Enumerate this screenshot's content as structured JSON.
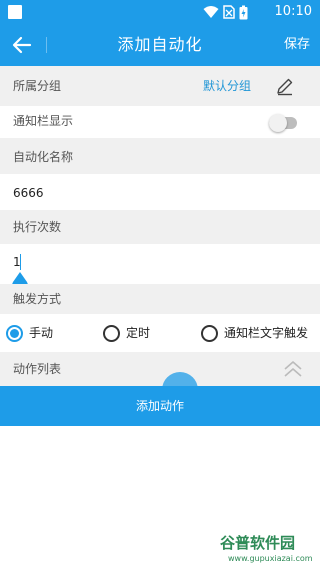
{
  "status_bar": {
    "time": "10:10",
    "icons": [
      "notification-square-icon",
      "wifi-icon",
      "no-sim-icon",
      "battery-charging-icon"
    ]
  },
  "app_bar": {
    "title": "添加自动化",
    "save_label": "保存",
    "back_icon": "arrow-left-icon"
  },
  "group": {
    "label": "所属分组",
    "value": "默认分组",
    "edit_icon": "edit-pencil-icon"
  },
  "notification_bar": {
    "label": "通知栏显示",
    "enabled": false
  },
  "automation_name": {
    "label": "自动化名称",
    "value": "6666"
  },
  "run_count": {
    "label": "执行次数",
    "value": "1"
  },
  "trigger": {
    "label": "触发方式",
    "options": [
      {
        "label": "手动",
        "selected": true
      },
      {
        "label": "定时",
        "selected": false
      },
      {
        "label": "通知栏文字触发",
        "selected": false
      }
    ]
  },
  "actions": {
    "label": "动作列表",
    "collapse_icon": "double-chevron-up-icon",
    "add_label": "添加动作"
  },
  "watermark": {
    "brand": "谷普软件园",
    "site": "www.gupuxiazai.com"
  },
  "colors": {
    "primary": "#1e9ce8",
    "link": "#2196d6",
    "label_bg": "#f0f0f0"
  }
}
